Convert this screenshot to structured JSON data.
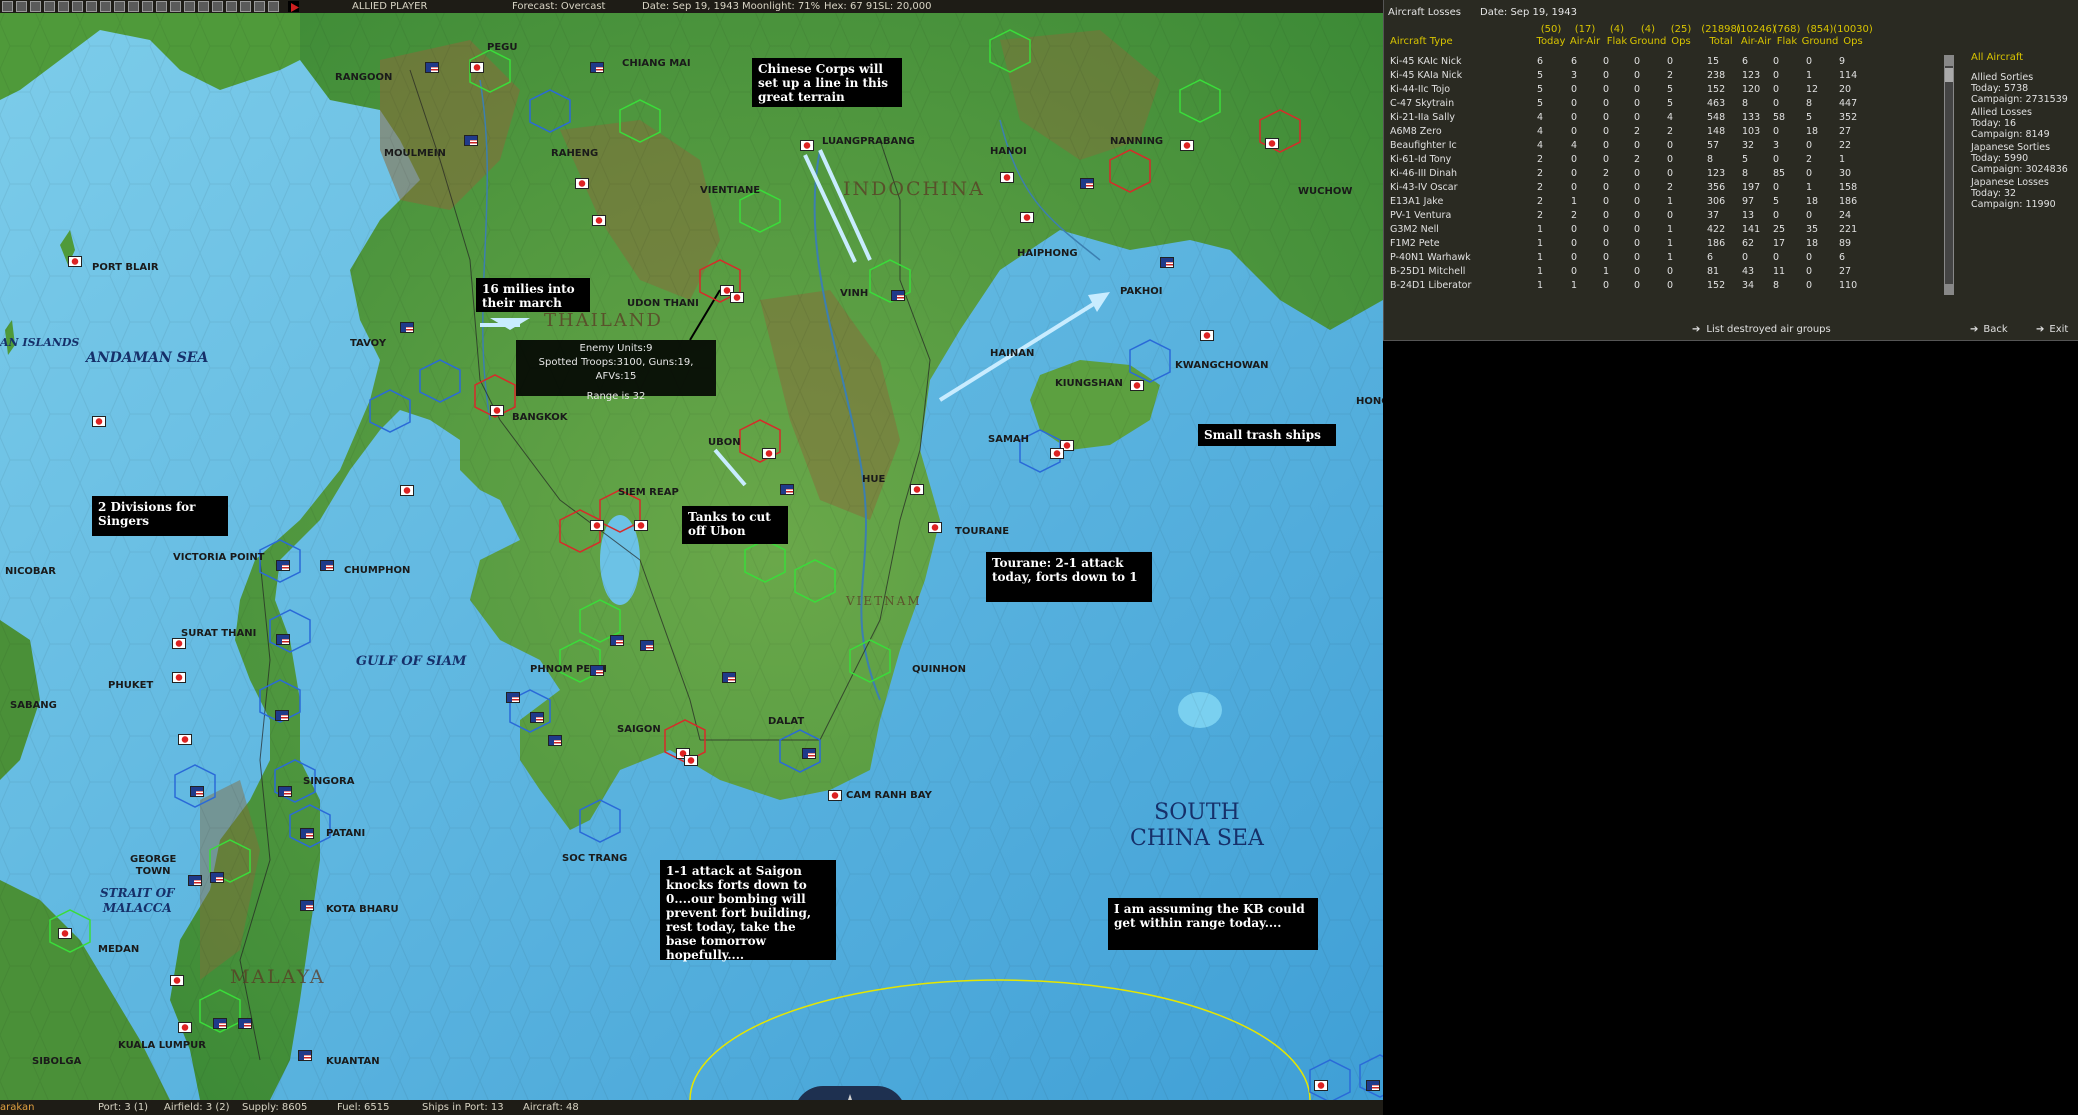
{
  "topbar": {
    "player": "ALLIED PLAYER",
    "forecast": "Forecast: Overcast",
    "date": "Date: Sep 19, 1943",
    "moonlight": "Moonlight: 71%",
    "hex": "Hex: 67 91",
    "sl": "SL: 20,000"
  },
  "bottombar": {
    "base": "arakan",
    "port": "Port: 3 (1)",
    "airfield": "Airfield: 3 (2)",
    "supply": "Supply: 8605",
    "fuel": "Fuel: 6515",
    "ships": "Ships in Port: 13",
    "aircraft": "Aircraft: 48"
  },
  "map_labels": {
    "rangoon": "RANGOON",
    "pegu": "PEGU",
    "chiang_mai": "CHIANG MAI",
    "moulmein": "MOULMEIN",
    "raheng": "RAHENG",
    "luangprabang": "LUANGPRABANG",
    "vientiane": "VIENTIANE",
    "hanoi": "HANOI",
    "nanning": "NANNING",
    "wuchow": "WUCHOW",
    "port_blair": "PORT BLAIR",
    "udon_thani": "UDON THANI",
    "haiphong": "HAIPHONG",
    "pakhoi": "PAKHOI",
    "tavoy": "TAVOY",
    "vinh": "VINH",
    "hainan": "HAINAN",
    "kwangchowan": "KWANGCHOWAN",
    "kiungshan": "KIUNGSHAN",
    "bangkok": "BANGKOK",
    "samah": "SAMAH",
    "ubon": "UBON",
    "hue": "HUE",
    "siem_reap": "SIEM REAP",
    "tourane": "TOURANE",
    "victoria_point": "VICTORIA POINT",
    "chumphon": "CHUMPHON",
    "nicobar": "NICOBAR",
    "surat_thani": "SURAT THANI",
    "phnom_penh": "PHNOM PENH",
    "quinhon": "QUINHON",
    "phuket": "PHUKET",
    "sabang": "SABANG",
    "saigon": "SAIGON",
    "dalat": "DALAT",
    "singora": "SINGORA",
    "patani": "PATANI",
    "cam_ranh_bay": "CAM RANH BAY",
    "soc_trang": "SOC TRANG",
    "george_town": "GEORGE\nTOWN",
    "kota_bharu": "KOTA BHARU",
    "medan": "MEDAN",
    "kuala_lumpur": "KUALA LUMPUR",
    "sibolga": "SIBOLGA",
    "kuantan": "KUANTAN",
    "hong": "HONG"
  },
  "regions": {
    "indochina": "INDOCHINA",
    "thailand": "THAILAND",
    "vietnam": "VIETNAM",
    "malaya": "MALAYA"
  },
  "seas": {
    "andaman_islands": "AN ISLANDS",
    "andaman_sea": "ANDAMAN SEA",
    "gulf_of_siam": "GULF OF SIAM",
    "strait_of_malacca": "STRAIT OF\nMALACCA",
    "south_china_sea": "SOUTH\nCHINA SEA"
  },
  "notes": {
    "chinese_corps": "Chinese Corps will set up a line in this great terrain",
    "sixteen_miles": "16 milies into their march",
    "two_divisions": "2 Divisions for Singers",
    "tanks": "Tanks to cut off Ubon",
    "tourane": "Tourane:  2-1 attack today, forts down to 1",
    "small_trash": "Small trash ships",
    "saigon_attack": "1-1 attack at Saigon knocks forts down to 0....our bombing will prevent fort building, rest today, take the base tomorrow hopefully....",
    "kb_range": "I am assuming the KB could get within range today...."
  },
  "tooltip": {
    "enemy_units": "Enemy Units:9",
    "spotted": "Spotted Troops:3100, Guns:19, AFVs:15",
    "range": "Range is 32"
  },
  "panel": {
    "title": "Aircraft Losses",
    "date": "Date: Sep 19, 1943",
    "type_header": "Aircraft Type",
    "column_totals": [
      "(50)",
      "(17)",
      "(4)",
      "(4)",
      "(25)",
      "(21898)",
      "(10246)",
      "(768)",
      "(854)",
      "(10030)"
    ],
    "column_headers": [
      "Today",
      "Air-Air",
      "Flak",
      "Ground",
      "Ops",
      "Total",
      "Air-Air",
      "Flak",
      "Ground",
      "Ops"
    ],
    "rows": [
      {
        "name": "Ki-45 KAIc Nick",
        "v": [
          "6",
          "6",
          "0",
          "0",
          "0",
          "15",
          "6",
          "0",
          "0",
          "9"
        ]
      },
      {
        "name": "Ki-45 KAIa Nick",
        "v": [
          "5",
          "3",
          "0",
          "0",
          "2",
          "238",
          "123",
          "0",
          "1",
          "114"
        ]
      },
      {
        "name": "Ki-44-IIc Tojo",
        "v": [
          "5",
          "0",
          "0",
          "0",
          "5",
          "152",
          "120",
          "0",
          "12",
          "20"
        ]
      },
      {
        "name": "C-47 Skytrain",
        "v": [
          "5",
          "0",
          "0",
          "0",
          "5",
          "463",
          "8",
          "0",
          "8",
          "447"
        ]
      },
      {
        "name": "Ki-21-IIa Sally",
        "v": [
          "4",
          "0",
          "0",
          "0",
          "4",
          "548",
          "133",
          "58",
          "5",
          "352"
        ]
      },
      {
        "name": "A6M8 Zero",
        "v": [
          "4",
          "0",
          "0",
          "2",
          "2",
          "148",
          "103",
          "0",
          "18",
          "27"
        ]
      },
      {
        "name": "Beaufighter Ic",
        "v": [
          "4",
          "4",
          "0",
          "0",
          "0",
          "57",
          "32",
          "3",
          "0",
          "22"
        ]
      },
      {
        "name": "Ki-61-Id Tony",
        "v": [
          "2",
          "0",
          "0",
          "2",
          "0",
          "8",
          "5",
          "0",
          "2",
          "1"
        ]
      },
      {
        "name": "Ki-46-III Dinah",
        "v": [
          "2",
          "0",
          "2",
          "0",
          "0",
          "123",
          "8",
          "85",
          "0",
          "30"
        ]
      },
      {
        "name": "Ki-43-IV Oscar",
        "v": [
          "2",
          "0",
          "0",
          "0",
          "2",
          "356",
          "197",
          "0",
          "1",
          "158"
        ]
      },
      {
        "name": "E13A1 Jake",
        "v": [
          "2",
          "1",
          "0",
          "0",
          "1",
          "306",
          "97",
          "5",
          "18",
          "186"
        ]
      },
      {
        "name": "PV-1 Ventura",
        "v": [
          "2",
          "2",
          "0",
          "0",
          "0",
          "37",
          "13",
          "0",
          "0",
          "24"
        ]
      },
      {
        "name": "G3M2 Nell",
        "v": [
          "1",
          "0",
          "0",
          "0",
          "1",
          "422",
          "141",
          "25",
          "35",
          "221"
        ]
      },
      {
        "name": "F1M2 Pete",
        "v": [
          "1",
          "0",
          "0",
          "0",
          "1",
          "186",
          "62",
          "17",
          "18",
          "89"
        ]
      },
      {
        "name": "P-40N1 Warhawk",
        "v": [
          "1",
          "0",
          "0",
          "0",
          "1",
          "6",
          "0",
          "0",
          "0",
          "6"
        ]
      },
      {
        "name": "B-25D1 Mitchell",
        "v": [
          "1",
          "0",
          "1",
          "0",
          "0",
          "81",
          "43",
          "11",
          "0",
          "27"
        ]
      },
      {
        "name": "B-24D1 Liberator",
        "v": [
          "1",
          "1",
          "0",
          "0",
          "0",
          "152",
          "34",
          "8",
          "0",
          "110"
        ]
      }
    ],
    "all_aircraft": "All Aircraft",
    "allied_sorties": "Allied Sorties",
    "allied_sorties_today": "Today:   5738",
    "allied_sorties_campaign": "Campaign: 2731539",
    "allied_losses": "Allied Losses",
    "allied_losses_today": "Today:   16",
    "allied_losses_campaign": "Campaign: 8149",
    "japanese_sorties": "Japanese Sorties",
    "japanese_sorties_today": "Today:   5990",
    "japanese_sorties_campaign": "Campaign: 3024836",
    "japanese_losses": "Japanese Losses",
    "japanese_losses_today": "Today:   32",
    "japanese_losses_campaign": "Campaign: 11990",
    "list_destroyed": "List destroyed air groups",
    "back": "Back",
    "exit": "Exit"
  },
  "colors": {
    "sea": "#6cc2e6",
    "deep_sea": "#4aa9d8",
    "land": "#4f9a3a",
    "mountain": "#8a6a3a",
    "allied_hex": "#2a6ad8",
    "japan_hex": "#d82a2a",
    "green_hex": "#3adc3a",
    "panel_header": "#d8c400"
  }
}
